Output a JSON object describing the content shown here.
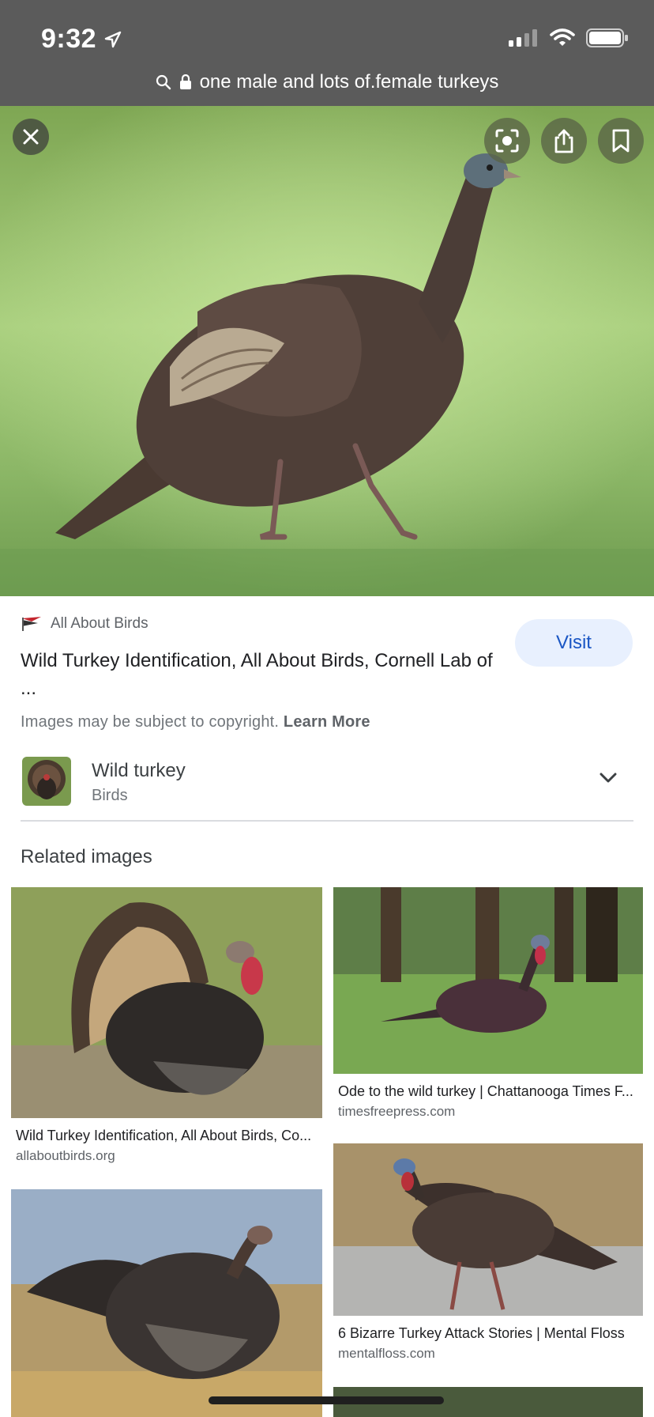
{
  "status_bar": {
    "time": "9:32"
  },
  "url_bar": {
    "query": "one male and lots of.female turkeys"
  },
  "hero": {
    "buttons": [
      "close-icon",
      "lens-icon",
      "share-icon",
      "bookmark-icon"
    ]
  },
  "result": {
    "source_name": "All About Birds",
    "title": "Wild Turkey Identification, All About Birds, Cornell Lab of ...",
    "visit_label": "Visit",
    "copyright_text": "Images may be subject to copyright.",
    "learn_more": "Learn More"
  },
  "knowledge": {
    "name": "Wild turkey",
    "category": "Birds"
  },
  "related": {
    "heading": "Related images",
    "items": [
      {
        "title": "Wild Turkey Identification, All About Birds, Co...",
        "site": "allaboutbirds.org"
      },
      {
        "title": "Ode to the wild turkey | Chattanooga Times F...",
        "site": "timesfreepress.com"
      },
      {
        "title": "6 Bizarre Turkey Attack Stories | Mental Floss",
        "site": "mentalfloss.com"
      }
    ]
  },
  "colors": {
    "accent": "#1a56c4",
    "visit_bg": "#e8f0fe",
    "top_bar": "#5b5b5b"
  }
}
